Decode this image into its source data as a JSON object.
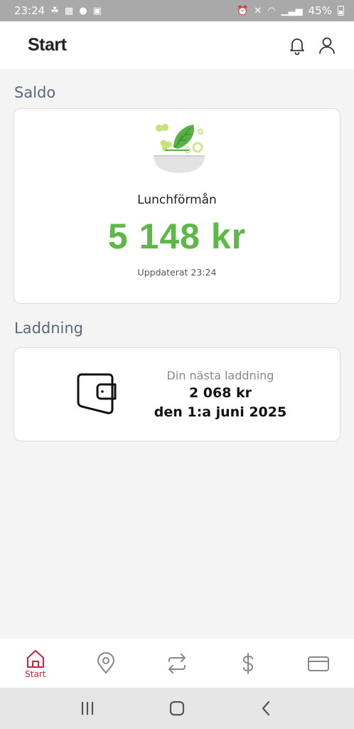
{
  "status_bar": {
    "time": "23:24",
    "battery": "45%"
  },
  "header": {
    "title": "Start"
  },
  "saldo": {
    "section_label": "Saldo",
    "benefit_name": "Lunchförmån",
    "balance": "5 148 kr",
    "updated": "Uppdaterat 23:24"
  },
  "charge": {
    "section_label": "Laddning",
    "caption": "Din nästa laddning",
    "amount": "2 068 kr",
    "date": "den 1:a juni 2025"
  },
  "bottom_nav": {
    "items": [
      {
        "label": "Start",
        "icon": "home-icon",
        "active": true
      },
      {
        "icon": "location-pin-icon"
      },
      {
        "icon": "transfer-arrows-icon"
      },
      {
        "icon": "dollar-icon"
      },
      {
        "icon": "card-icon"
      }
    ]
  },
  "colors": {
    "accent": "#c8243a",
    "balance_green": "#5cb946"
  }
}
